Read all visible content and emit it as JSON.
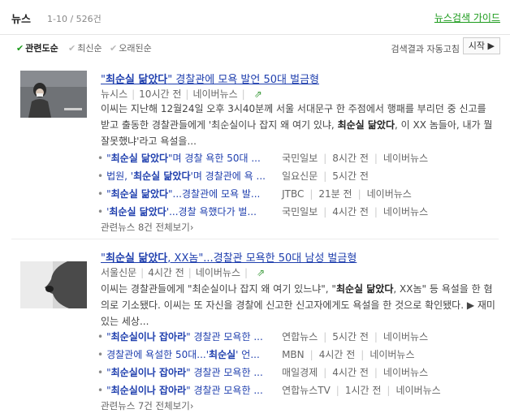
{
  "header": {
    "title": "뉴스",
    "count": "1-10 / 526건",
    "guide": "뉴스검색 가이드"
  },
  "sort": {
    "options": [
      "관련도순",
      "최신순",
      "오래된순"
    ],
    "active": 0,
    "autorefresh": "검색결과 자동고침",
    "start": "시작 ▶"
  },
  "articles": [
    {
      "title_pre": "\"",
      "title_hl": "최순실 닮았다",
      "title_post": "\" 경찰관에 모욕 발언 50대 벌금형",
      "source": "뉴시스",
      "time": "10시간 전",
      "naver": "네이버뉴스",
      "desc_pre": "이씨는 지난해 12월24일 오후 3시40분께 서울 서대문구 한 주점에서 행패를 부리던 중 신고를 받고 출동한 경찰관들에게 '최순실이나 잡지 왜 여기 있냐,",
      "desc_hl": "최순실 닮았다",
      "desc_post": ", 이 XX 놈들아, 내가 뭘 잘못했냐'라고 욕설을...",
      "related": [
        {
          "pre": "\"",
          "hl": "최순실 닮았다",
          "post": "\"며 경찰 욕한 50대 ...",
          "src": "국민일보",
          "time": "8시간 전",
          "nv": "네이버뉴스"
        },
        {
          "pre": "법원, '",
          "hl": "최순실 닮았다",
          "post": "'며 경찰관에 욕 ...",
          "src": "일요신문",
          "time": "5시간 전",
          "nv": ""
        },
        {
          "pre": "\"",
          "hl": "최순실 닮았다",
          "post": "\"...경찰관에 모욕 발...",
          "src": "JTBC",
          "time": "21분 전",
          "nv": "네이버뉴스"
        },
        {
          "pre": "'",
          "hl": "최순실 닮았다",
          "post": "'...경찰 욕했다가 벌...",
          "src": "국민일보",
          "time": "4시간 전",
          "nv": "네이버뉴스"
        }
      ],
      "more": "관련뉴스 8건 전체보기›"
    },
    {
      "title_pre": "\"",
      "title_hl": "최순실 닮았다",
      "title_post": ", XX놈\"...경찰관 모욕한 50대 남성 벌금형",
      "source": "서울신문",
      "time": "4시간 전",
      "naver": "네이버뉴스",
      "desc_pre": "이씨는 경찰관들에게 \"최순실이나 잡지 왜 여기 있느냐\", \"",
      "desc_hl": "최순실 닮았다",
      "desc_post": ", XX놈\" 등 욕설을 한 혐의로 기소됐다. 이씨는 또 자신을 경찰에 신고한 신고자에게도 욕설을 한 것으로 확인됐다. ▶ 재미있는 세상...",
      "related": [
        {
          "pre": "\"",
          "hl": "최순실이나 잡아라",
          "post": "\" 경찰관 모욕한 ...",
          "src": "연합뉴스",
          "time": "5시간 전",
          "nv": "네이버뉴스"
        },
        {
          "pre": "경찰관에 욕설한 50대...'",
          "hl": "최순실",
          "post": "' 언...",
          "src": "MBN",
          "time": "4시간 전",
          "nv": "네이버뉴스"
        },
        {
          "pre": "\"",
          "hl": "최순실이나 잡아라",
          "post": "\" 경찰관 모욕한 ...",
          "src": "매일경제",
          "time": "4시간 전",
          "nv": "네이버뉴스"
        },
        {
          "pre": "\"",
          "hl": "최순실이나 잡아라",
          "post": "\" 경찰관 모욕한 ...",
          "src": "연합뉴스TV",
          "time": "1시간 전",
          "nv": "네이버뉴스"
        }
      ],
      "more": "관련뉴스 7건 전체보기›"
    }
  ]
}
